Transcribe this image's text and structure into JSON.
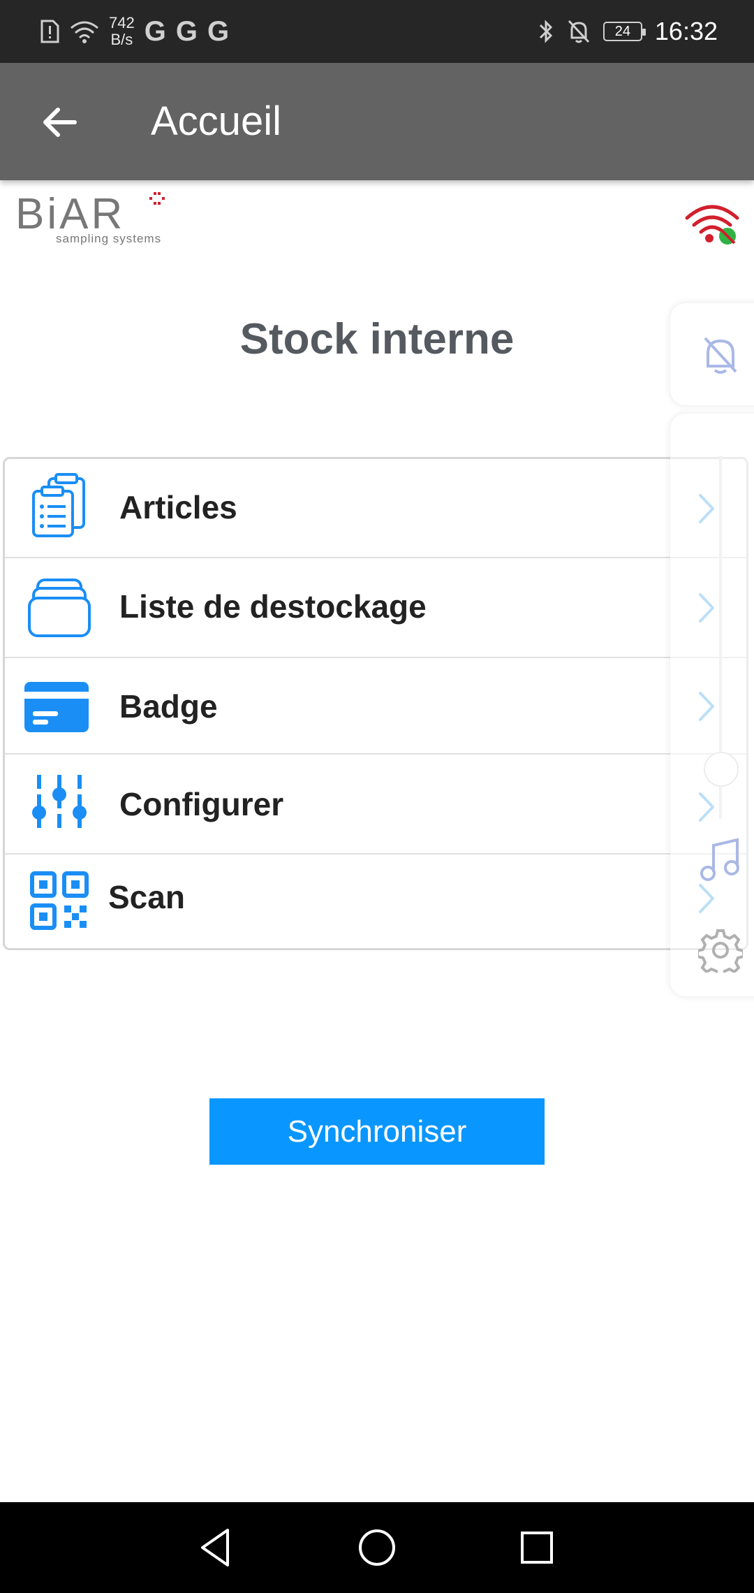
{
  "status_bar": {
    "net_speed_value": "742",
    "net_speed_unit": "B/s",
    "g_icons": [
      "G",
      "G",
      "G"
    ],
    "battery": "24",
    "time": "16:32"
  },
  "app_bar": {
    "title": "Accueil"
  },
  "logo": {
    "name": "BiAR",
    "tagline": "sampling systems"
  },
  "page": {
    "title": "Stock interne"
  },
  "menu": {
    "items": [
      {
        "label": "Articles",
        "icon": "clipboard-icon"
      },
      {
        "label": "Liste de destockage",
        "icon": "stack-icon"
      },
      {
        "label": "Badge",
        "icon": "card-icon"
      },
      {
        "label": "Configurer",
        "icon": "sliders-icon"
      },
      {
        "label": "Scan",
        "icon": "qr-code-icon"
      }
    ]
  },
  "actions": {
    "sync_label": "Synchroniser"
  },
  "colors": {
    "accent": "#0a96ff",
    "app_bar": "#636363",
    "status_bar": "#262626",
    "title_text": "#555a60"
  }
}
